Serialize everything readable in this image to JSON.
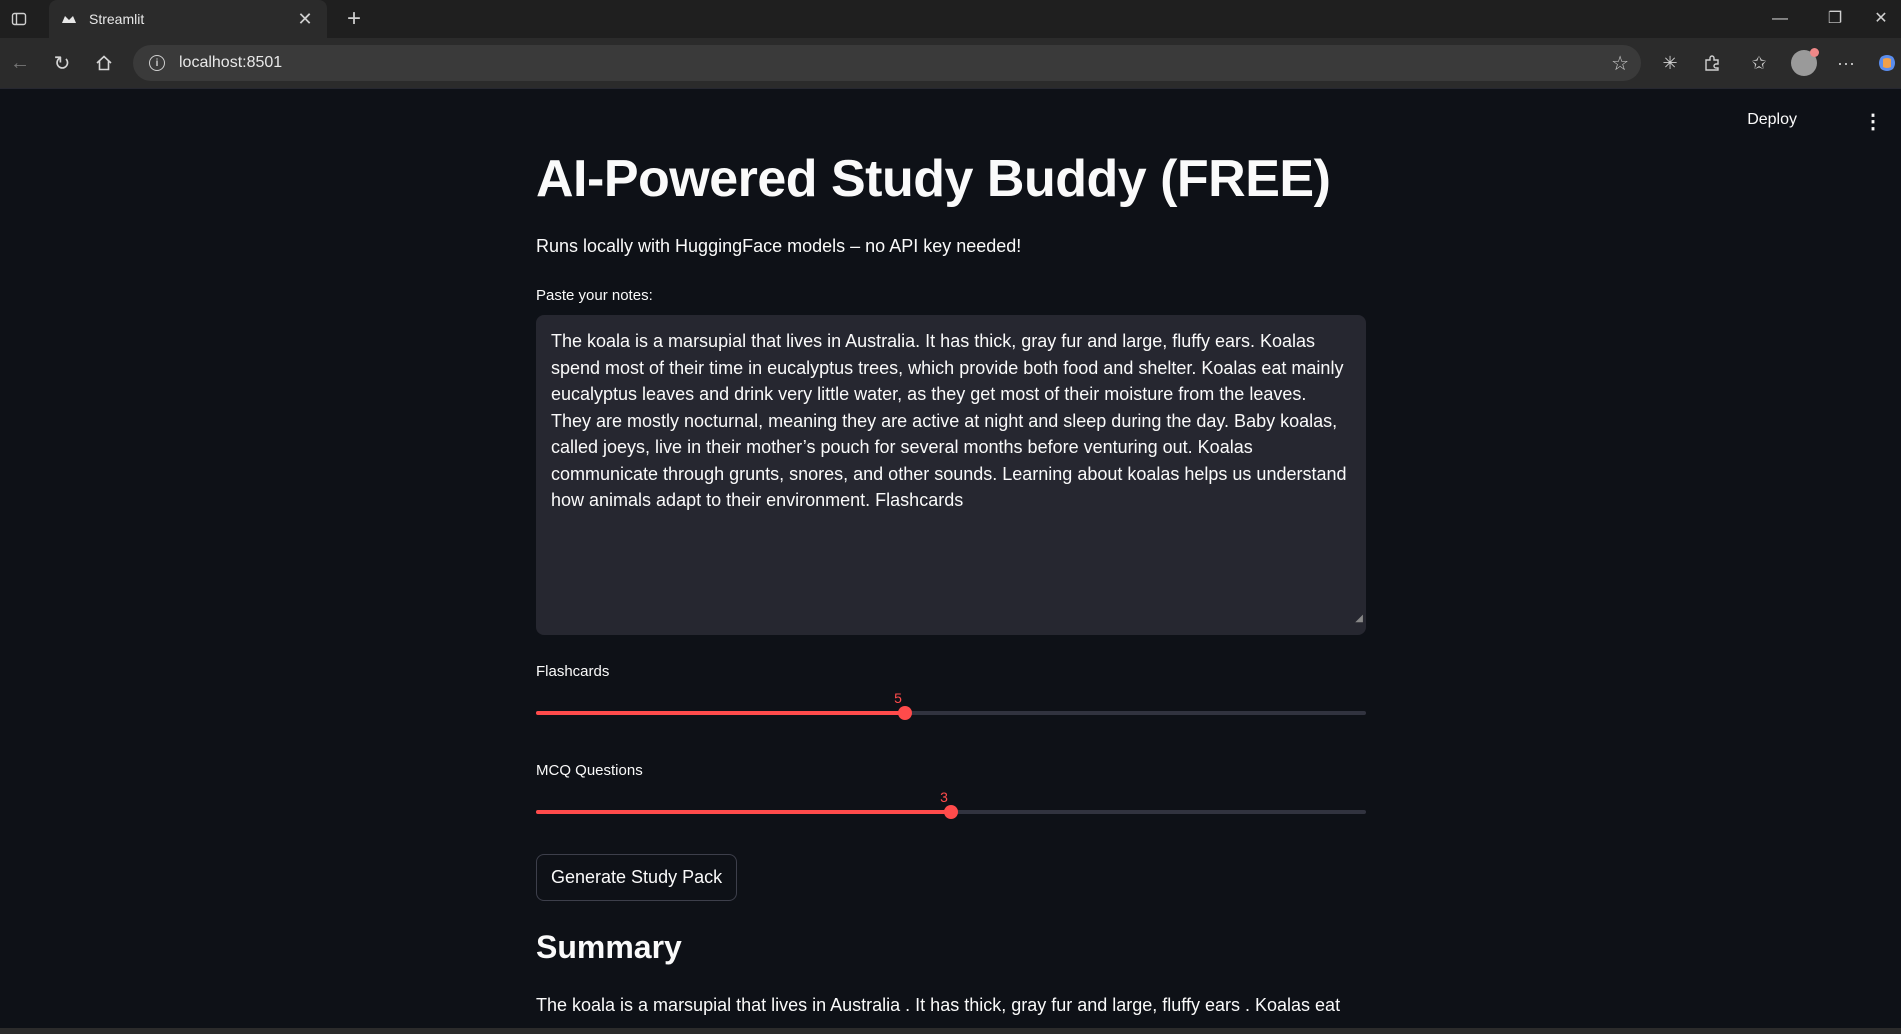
{
  "browser": {
    "tab_title": "Streamlit",
    "address": "localhost:8501"
  },
  "app": {
    "deploy_label": "Deploy",
    "title": "AI-Powered Study Buddy (FREE)",
    "subtitle": "Runs locally with HuggingFace models – no API key needed!",
    "notes_label": "Paste your notes:",
    "notes_value": "The koala is a marsupial that lives in Australia. It has thick, gray fur and large, fluffy ears. Koalas spend most of their time in eucalyptus trees, which provide both food and shelter. Koalas eat mainly eucalyptus leaves and drink very little water, as they get most of their moisture from the leaves. They are mostly nocturnal, meaning they are active at night and sleep during the day. Baby koalas, called joeys, live in their mother’s pouch for several months before venturing out. Koalas communicate through grunts, snores, and other sounds. Learning about koalas helps us understand how animals adapt to their environment. Flashcards",
    "flashcards_slider": {
      "label": "Flashcards",
      "value": "5",
      "fraction": 0.445
    },
    "mcq_slider": {
      "label": "MCQ Questions",
      "value": "3",
      "fraction": 0.5
    },
    "generate_button": "Generate Study Pack",
    "summary_heading": "Summary",
    "summary_text": "The koala is a marsupial that lives in Australia . It has thick, gray fur and large, fluffy ears . Koalas eat"
  },
  "colors": {
    "accent": "#ff4b4b",
    "background": "#0e1117",
    "input_bg": "#262730"
  }
}
